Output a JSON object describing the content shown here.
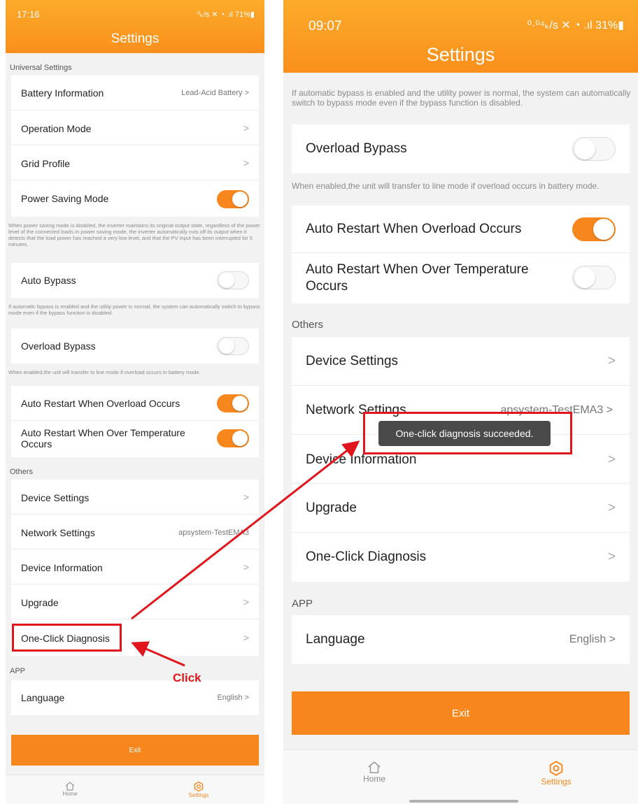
{
  "colors": {
    "accent": "#f7861c",
    "highlight": "#e0161c",
    "toast_bg": "#4a4a4a"
  },
  "left": {
    "status": {
      "time": "17:16",
      "icons": "⁰ₖ/s ✕ ◔ .ıl 71%▮"
    },
    "title": "Settings",
    "universal_label": "Universal Settings",
    "battery": {
      "label": "Battery Information",
      "value": "Lead-Acid Battery >"
    },
    "operation_mode": {
      "label": "Operation Mode",
      "chevron": ">"
    },
    "grid_profile": {
      "label": "Grid Profile",
      "chevron": ">"
    },
    "power_saving": {
      "label": "Power Saving Mode",
      "state": "on"
    },
    "power_saving_note": "When power saving mode is disabled, the inverter maintains its original output state, regardless of the power level of the connected loads.In power saving mode, the inverter automatically cuts off its output when it detects that the load power has reached a very low level, and that the PV input has been interrupted for 5 minutes.",
    "auto_bypass": {
      "label": "Auto Bypass",
      "state": "off"
    },
    "auto_bypass_note": "If automatic bypass is enabled and the utility power is normal, the system can automatically switch to bypass mode even if the bypass function is disabled.",
    "overload_bypass": {
      "label": "Overload Bypass",
      "state": "off"
    },
    "overload_bypass_note": "When enabled,the unit will transfer to line mode if overload occurs in battery mode.",
    "auto_restart_overload": {
      "label": "Auto Restart When Overload Occurs",
      "state": "on"
    },
    "auto_restart_temp": {
      "label": "Auto Restart When Over Temperature Occurs",
      "state": "on"
    },
    "others_label": "Others",
    "device_settings": {
      "label": "Device Settings",
      "chevron": ">"
    },
    "network_settings": {
      "label": "Network Settings",
      "value": "apsystem-TestEMA3"
    },
    "device_information": {
      "label": "Device Information",
      "chevron": ">"
    },
    "upgrade": {
      "label": "Upgrade",
      "chevron": ">"
    },
    "one_click": {
      "label": "One-Click Diagnosis",
      "chevron": ">"
    },
    "app_label": "APP",
    "language": {
      "label": "Language",
      "value": "English >"
    },
    "exit": "Exit",
    "tabs": {
      "home": "Home",
      "settings": "Settings"
    }
  },
  "right": {
    "status": {
      "time": "09:07",
      "icons": "⁰·⁰⁴ₖ/s ✕ ◔ .ıl 31%▮"
    },
    "title": "Settings",
    "auto_bypass_note": "If automatic bypass is enabled and the utility power is normal, the system can automatically switch to bypass mode even if the bypass function is disabled.",
    "overload_bypass": {
      "label": "Overload Bypass",
      "state": "off"
    },
    "overload_bypass_note": "When enabled,the unit will transfer to line mode if overload occurs in battery mode.",
    "auto_restart_overload": {
      "label": "Auto Restart When Overload Occurs",
      "state": "on"
    },
    "auto_restart_temp": {
      "label": "Auto Restart When Over Temperature Occurs",
      "state": "off"
    },
    "others_label": "Others",
    "device_settings": {
      "label": "Device Settings",
      "chevron": ">"
    },
    "network_settings": {
      "label": "Network Settings",
      "value": "apsystem-TestEMA3 >"
    },
    "device_information": {
      "label": "Device Information",
      "chevron": ">"
    },
    "upgrade": {
      "label": "Upgrade",
      "chevron": ">"
    },
    "one_click": {
      "label": "One-Click Diagnosis",
      "chevron": ">"
    },
    "app_label": "APP",
    "language": {
      "label": "Language",
      "value": "English >"
    },
    "exit": "Exit",
    "toast": "One-click diagnosis succeeded.",
    "tabs": {
      "home": "Home",
      "settings": "Settings"
    }
  },
  "annotation": {
    "click_label": "Click"
  }
}
